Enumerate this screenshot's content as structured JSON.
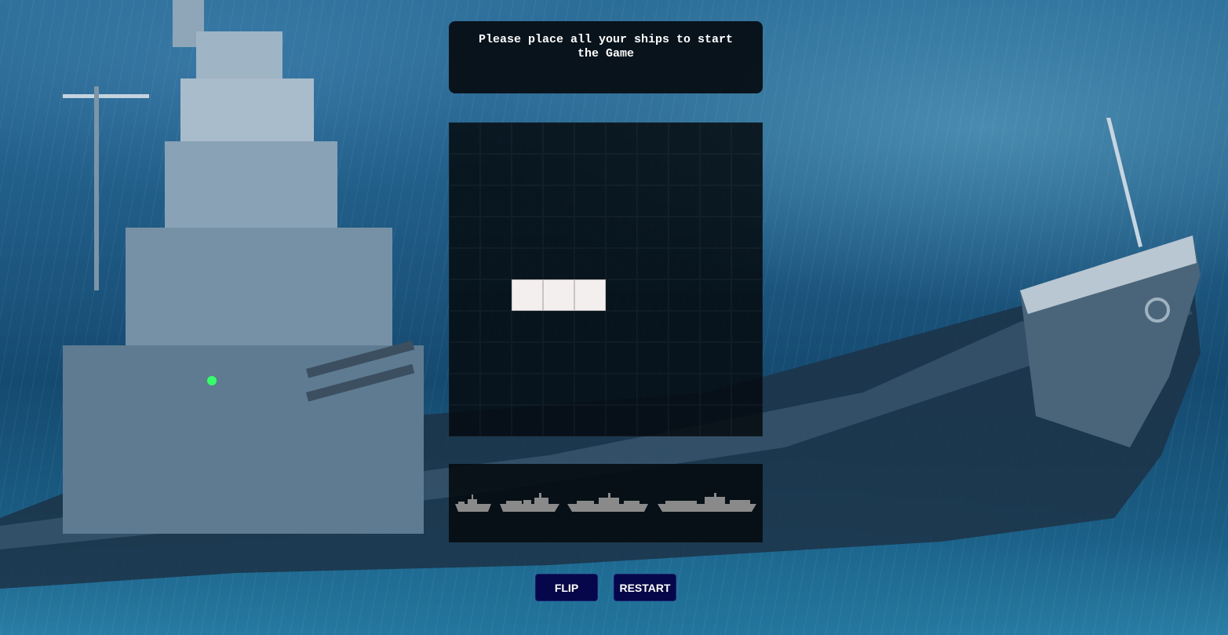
{
  "status_message": "Please place all your ships to start the Game",
  "board": {
    "rows": 10,
    "cols": 10,
    "placed_ship": {
      "row": 5,
      "col_start": 2,
      "length": 3
    }
  },
  "dock_ships": [
    {
      "name": "destroyer",
      "icon": "destroyer-ship-icon"
    },
    {
      "name": "submarine",
      "icon": "submarine-ship-icon"
    },
    {
      "name": "battleship",
      "icon": "battleship-ship-icon"
    },
    {
      "name": "carrier",
      "icon": "carrier-ship-icon"
    }
  ],
  "controls": {
    "flip_label": "FLIP",
    "restart_label": "RESTART"
  },
  "colors": {
    "button_bg": "#05074a",
    "ship_placed": "#f4efef",
    "dock_ship": "#8a8a8a"
  }
}
